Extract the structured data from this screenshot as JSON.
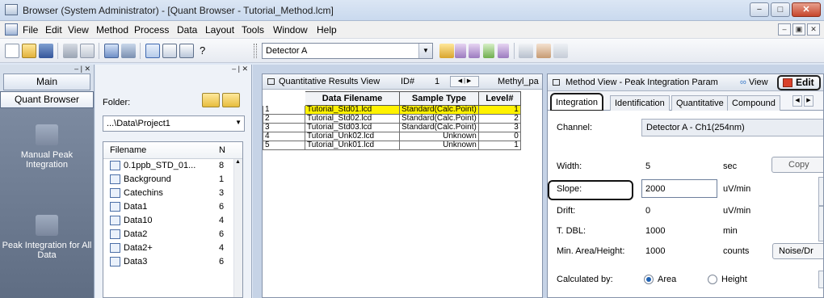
{
  "window": {
    "title": "Browser (System Administrator) - [Quant Browser - Tutorial_Method.lcm]",
    "minimize": "−",
    "maximize": "□",
    "close": "✕"
  },
  "menu": {
    "items": [
      "File",
      "Edit",
      "View",
      "Method",
      "Process",
      "Data",
      "Layout",
      "Tools",
      "Window",
      "Help"
    ],
    "mdi_min": "–",
    "mdi_restore": "▣",
    "mdi_close": "✕"
  },
  "toolbar": {
    "detector": "Detector A",
    "help": "?"
  },
  "left_panel": {
    "main": "Main",
    "quant_browser": "Quant Browser",
    "nav": [
      {
        "label": "Manual Peak Integration"
      },
      {
        "label": "Peak Integration for All Data"
      }
    ]
  },
  "file_panel": {
    "folder_label": "Folder:",
    "path": "...\\Data\\Project1",
    "col_filename": "Filename",
    "col_n": "N",
    "files": [
      {
        "name": "0.1ppb_STD_01...",
        "n": "8"
      },
      {
        "name": "Background",
        "n": "1"
      },
      {
        "name": "Catechins",
        "n": "3"
      },
      {
        "name": "Data1",
        "n": "6"
      },
      {
        "name": "Data10",
        "n": "4"
      },
      {
        "name": "Data2",
        "n": "6"
      },
      {
        "name": "Data2+",
        "n": "4"
      },
      {
        "name": "Data3",
        "n": "6"
      }
    ]
  },
  "quant": {
    "title": "Quantitative Results View",
    "id_label": "ID#",
    "id_value": "1",
    "compound": "Methyl_pa",
    "headers": [
      "Data Filename",
      "Sample Type",
      "Level#"
    ],
    "rows": [
      {
        "no": "1",
        "file": "Tutorial_Std01.lcd",
        "type": "Standard(Calc.Point)",
        "level": "1",
        "highlight": true
      },
      {
        "no": "2",
        "file": "Tutorial_Std02.lcd",
        "type": "Standard(Calc.Point)",
        "level": "2",
        "highlight": false
      },
      {
        "no": "3",
        "file": "Tutorial_Std03.lcd",
        "type": "Standard(Calc.Point)",
        "level": "3",
        "highlight": false
      },
      {
        "no": "4",
        "file": "Tutorial_Unk02.lcd",
        "type": "Unknown",
        "level": "0",
        "highlight": false
      },
      {
        "no": "5",
        "file": "Tutorial_Unk01.lcd",
        "type": "Unknown",
        "level": "1",
        "highlight": false
      }
    ]
  },
  "method": {
    "title": "Method View - Peak Integration Param",
    "view": "View",
    "edit": "Edit",
    "tabs": [
      "Integration",
      "Identification",
      "Quantitative",
      "Compound"
    ],
    "channel_label": "Channel:",
    "channel_value": "Detector A - Ch1(254nm)",
    "width_label": "Width:",
    "width_value": "5",
    "width_unit": "sec",
    "copy": "Copy",
    "slope_label": "Slope:",
    "slope_value": "2000",
    "slope_unit": "uV/min",
    "drift_label": "Drift:",
    "drift_value": "0",
    "drift_unit": "uV/min",
    "tdbl_label": "T. DBL:",
    "tdbl_value": "1000",
    "tdbl_unit": "min",
    "minarea_label": "Min. Area/Height:",
    "minarea_value": "1000",
    "minarea_unit": "counts",
    "noise": "Noise/Dr",
    "calc_label": "Calculated by:",
    "calc_area": "Area",
    "calc_height": "Height"
  }
}
